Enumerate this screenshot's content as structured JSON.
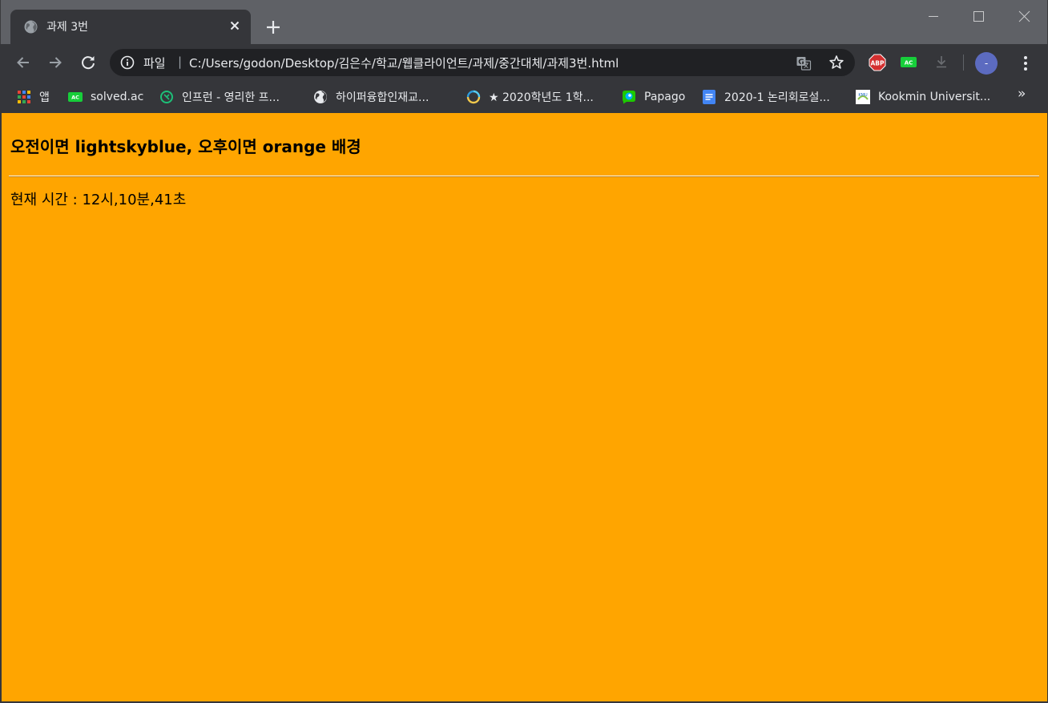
{
  "tab": {
    "title": "과제 3번"
  },
  "toolbar": {
    "scheme_label": "파일",
    "separator": "|",
    "url": "C:/Users/godon/Desktop/김은수/학교/웹클라이언트/과제/중간대체/과제3번.html",
    "avatar_letter": "-",
    "abp_label": "ABP",
    "ac_label": "AC"
  },
  "bookmarks": {
    "items": [
      {
        "label": "앱",
        "icon": "apps-grid-icon"
      },
      {
        "label": "solved.ac",
        "icon": "solvedac-icon"
      },
      {
        "label": "인프런 - 영리한 프...",
        "icon": "inflearn-icon"
      },
      {
        "label": "하이퍼융합인재교...",
        "icon": "globe-icon"
      },
      {
        "label": "★ 2020학년도 1학...",
        "icon": "kookmin-loader-icon"
      },
      {
        "label": "Papago",
        "icon": "papago-icon"
      },
      {
        "label": "2020-1 논리회로설...",
        "icon": "google-docs-icon"
      },
      {
        "label": "Kookmin Universit...",
        "icon": "kookmin-univ-icon"
      }
    ],
    "more": "»"
  },
  "page": {
    "heading": "오전이면 lightskyblue, 오후이면 orange 배경",
    "time_text": "현재 시간 : 12시,10분,41초",
    "background": "#ffa500"
  },
  "colors": {
    "tabstrip": "#5f6166",
    "toolbar": "#35363a",
    "omnibox": "#202124"
  }
}
